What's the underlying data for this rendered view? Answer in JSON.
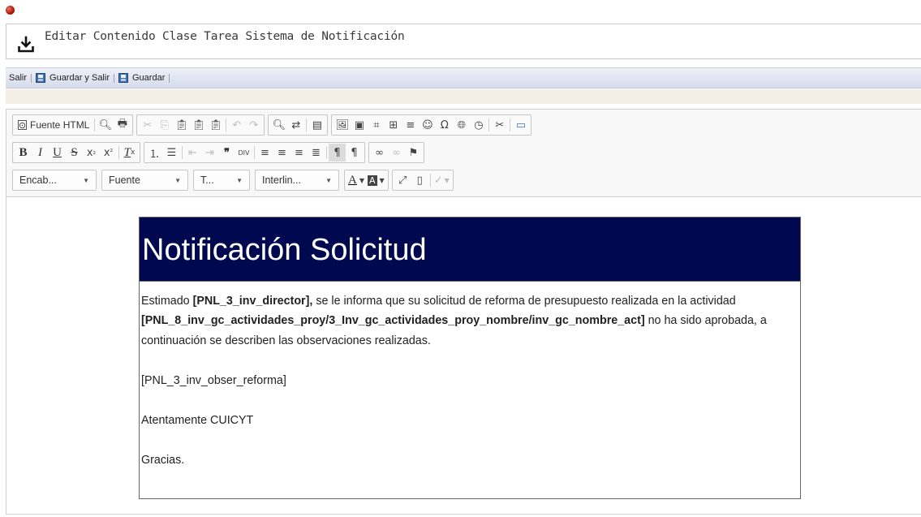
{
  "window": {
    "title": "Editar Contenido Clase Tarea Sistema de Notificación",
    "title_icon": "download-icon"
  },
  "actions": [
    {
      "label": "Salir",
      "icon": null
    },
    {
      "label": "Guardar y Salir",
      "icon": "floppy-icon"
    },
    {
      "label": "Guardar",
      "icon": "floppy-icon"
    }
  ],
  "editor": {
    "toolbar": {
      "source_label": "Fuente HTML",
      "combos": {
        "format": "Encab...",
        "font": "Fuente",
        "size": "T...",
        "line_height": "Interlin..."
      }
    },
    "document": {
      "heading": "Notificación Solicitud",
      "p1_a": "Estimado ",
      "p1_b": "[PNL_3_inv_director],",
      "p1_c": " se le informa que su solicitud de reforma de presupuesto realizada en la actividad ",
      "p1_d": "[PNL_8_inv_gc_actividades_proy/3_Inv_gc_actividades_proy_nombre/inv_gc_nombre_act]",
      "p1_e": " no ha sido aprobada, a continuación se describen las observaciones realizadas.",
      "p2": "[PNL_3_inv_obser_reforma]",
      "p3": "Atentamente CUICYT",
      "p4": "Gracias."
    }
  },
  "colors": {
    "heading_bg": "#000850",
    "heading_text": "#ffffff",
    "action_bar": "#dde2f0"
  }
}
